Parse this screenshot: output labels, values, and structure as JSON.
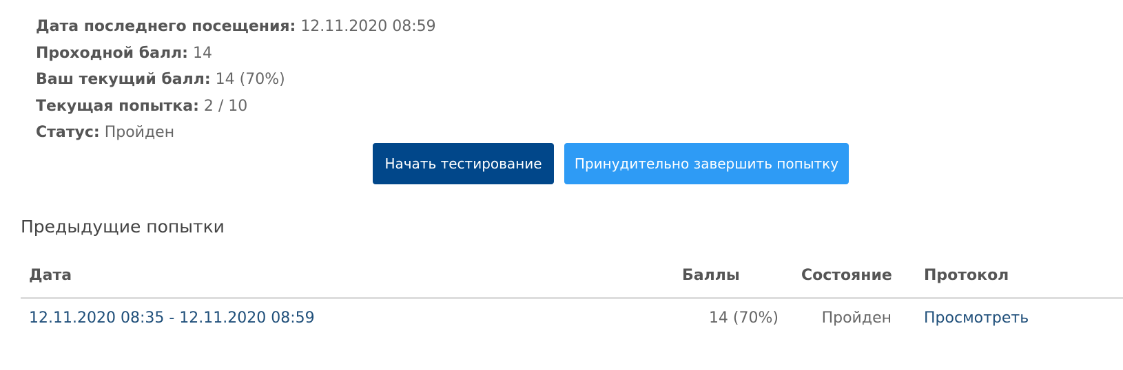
{
  "info": {
    "last_visit_label": "Дата последнего посещения:",
    "last_visit_value": "12.11.2020 08:59",
    "passing_score_label": "Проходной балл:",
    "passing_score_value": "14",
    "current_score_label": "Ваш текущий балл:",
    "current_score_value": "14 (70%)",
    "current_attempt_label": "Текущая попытка:",
    "current_attempt_value": "2 / 10",
    "status_label": "Статус:",
    "status_value": "Пройден"
  },
  "actions": {
    "start_label": "Начать тестирование",
    "force_finish_label": "Принудительно завершить попытку"
  },
  "previous_attempts": {
    "title": "Предыдущие попытки",
    "columns": {
      "date": "Дата",
      "score": "Баллы",
      "state": "Состояние",
      "protocol": "Протокол"
    },
    "rows": [
      {
        "date": "12.11.2020 08:35 - 12.11.2020 08:59",
        "score": "14 (70%)",
        "state": "Пройден",
        "protocol": "Просмотреть"
      }
    ]
  },
  "colors": {
    "primary_button": "#01478a",
    "secondary_button": "#2e9bf5",
    "link": "#1f4f7a"
  }
}
